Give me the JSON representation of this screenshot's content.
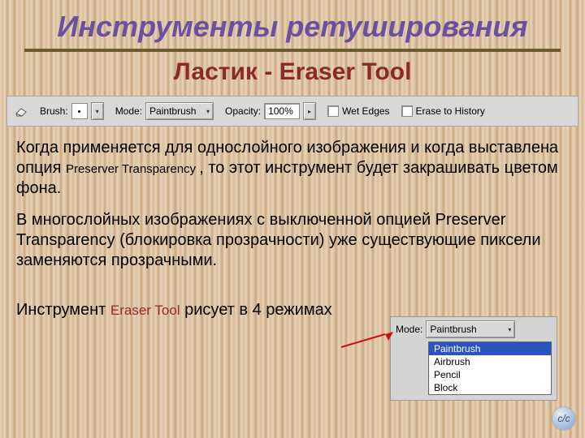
{
  "title": "Инструменты ретуширования",
  "subtitle": "Ластик - Eraser Tool",
  "toolbar": {
    "brush_label": "Brush:",
    "mode_label": "Mode:",
    "mode_value": "Paintbrush",
    "opacity_label": "Opacity:",
    "opacity_value": "100%",
    "wet_edges_label": "Wet Edges",
    "erase_history_label": "Erase to History"
  },
  "para1_a": "Когда применяется для однослойного изображения и когда выставлена опция ",
  "para1_b": "Preserver Transparency ",
  "para1_c": ", то этот инструмент будет закрашивать цветом фона.",
  "para2": "В многослойных изображениях с выключенной опцией Preserver Transparency (блокировка прозрачности) уже существующие пиксели заменяются прозрачными.",
  "para3_a": "Инструмент ",
  "para3_b": "Eraser Tool",
  "para3_c": " рисует в 4 режимах",
  "mode_panel": {
    "label": "Mode:",
    "selected": "Paintbrush",
    "options": [
      "Paintbrush",
      "Airbrush",
      "Pencil",
      "Block"
    ]
  },
  "logo": "c/c"
}
